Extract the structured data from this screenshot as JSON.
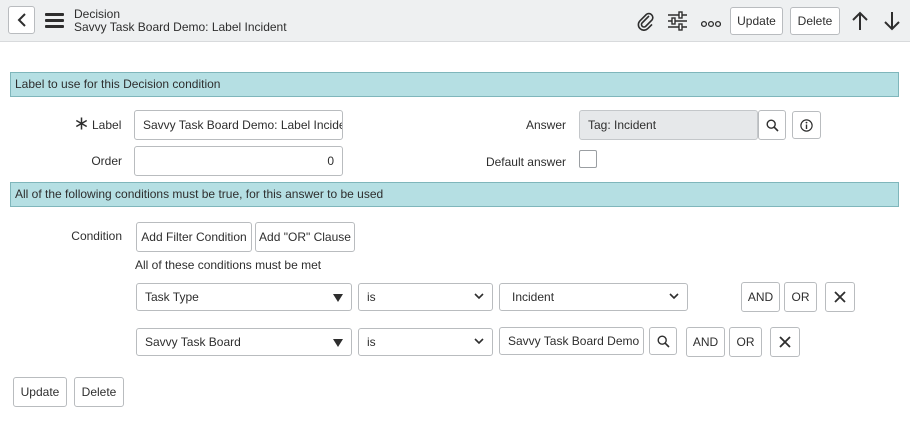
{
  "header": {
    "record_type": "Decision",
    "record_name": "Savvy Task Board Demo: Label Incident",
    "update_label": "Update",
    "delete_label": "Delete"
  },
  "sections": {
    "label_section": "Label to use for this Decision condition",
    "condition_section": "All of the following conditions must be true, for this answer to be used"
  },
  "form": {
    "label_field_label": "Label",
    "label_value": "Savvy Task Board Demo: Label Incident",
    "order_label": "Order",
    "order_value": "0",
    "answer_label": "Answer",
    "answer_value": "Tag: Incident",
    "default_answer_label": "Default answer",
    "default_answer_checked": false,
    "condition_label": "Condition"
  },
  "condition_builder": {
    "add_filter_label": "Add Filter Condition",
    "add_or_label": "Add \"OR\" Clause",
    "all_met_text": "All of these conditions must be met",
    "rows": [
      {
        "field": "Task Type",
        "operator": "is",
        "value": "Incident",
        "and": "AND",
        "or": "OR"
      },
      {
        "field": "Savvy Task Board",
        "operator": "is",
        "value": "Savvy Task Board Demo",
        "and": "AND",
        "or": "OR"
      }
    ]
  },
  "footer": {
    "update_label": "Update",
    "delete_label": "Delete"
  }
}
